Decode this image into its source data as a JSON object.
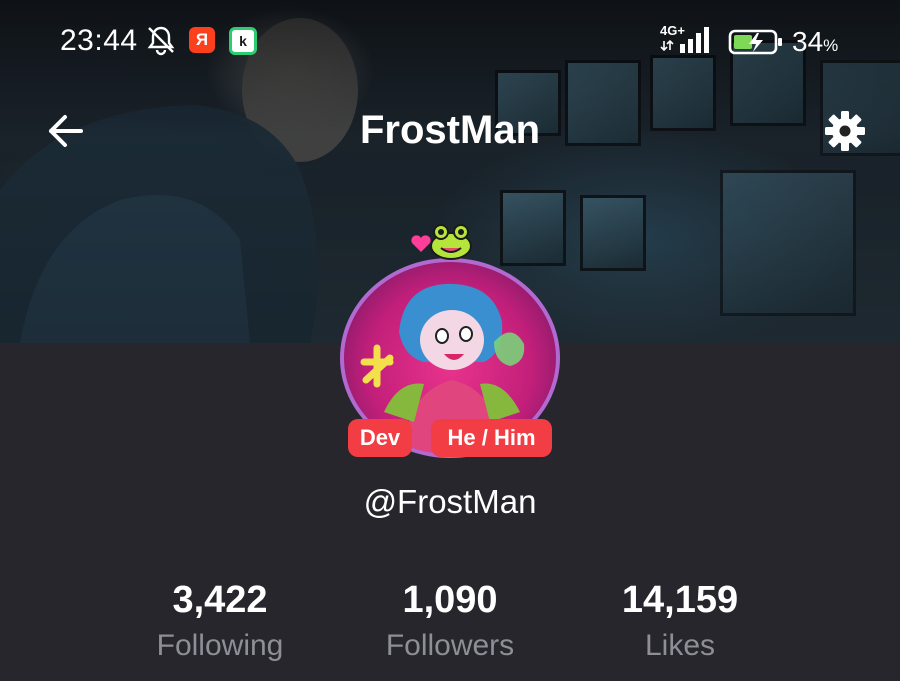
{
  "status_bar": {
    "time": "23:44",
    "battery_percent": "34",
    "battery_suffix": "%",
    "network": "4G+",
    "notification_apps": [
      {
        "name": "yandex-app-icon",
        "glyph": "Я",
        "color": "#fc3f1d"
      },
      {
        "name": "k-app-icon",
        "glyph": "k",
        "color": "#2ecc71"
      }
    ],
    "battery_charging": true
  },
  "header": {
    "title": "FrostMan",
    "back_icon": "arrow-left-icon",
    "settings_icon": "gear-icon"
  },
  "profile": {
    "badges": [
      "Dev",
      "He / Him"
    ],
    "username": "@FrostMan",
    "stats": [
      {
        "value": "3,422",
        "label": "Following"
      },
      {
        "value": "1,090",
        "label": "Followers"
      },
      {
        "value": "14,159",
        "label": "Likes"
      }
    ]
  },
  "colors": {
    "background": "#26262c",
    "badge": "#f33d44",
    "muted_text": "#8e8e96",
    "avatar_ring": "#b06ad0"
  }
}
